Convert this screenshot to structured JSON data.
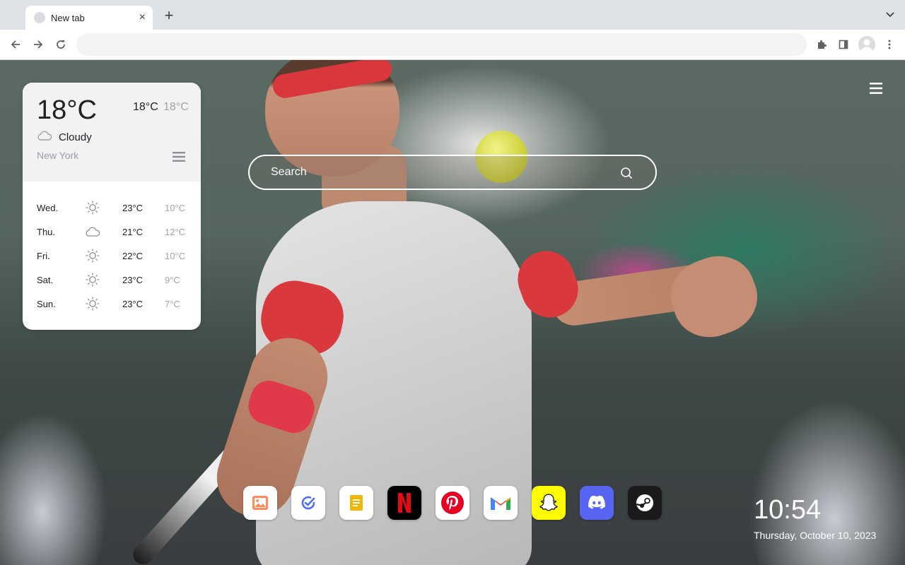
{
  "browser": {
    "tab": {
      "title": "New tab",
      "close": "×"
    },
    "new_tab": "+",
    "address": ""
  },
  "weather": {
    "current_temp": "18°C",
    "high": "18°C",
    "low": "18°C",
    "condition": "Cloudy",
    "city": "New York",
    "forecast": [
      {
        "day": "Wed.",
        "icon": "sun-icon",
        "high": "23°C",
        "low": "10°C"
      },
      {
        "day": "Thu.",
        "icon": "cloud-icon",
        "high": "21°C",
        "low": "12°C"
      },
      {
        "day": "Fri.",
        "icon": "sun-icon",
        "high": "22°C",
        "low": "10°C"
      },
      {
        "day": "Sat.",
        "icon": "sun-icon",
        "high": "23°C",
        "low": "9°C"
      },
      {
        "day": "Sun.",
        "icon": "sun-icon",
        "high": "23°C",
        "low": "7°C"
      }
    ]
  },
  "search": {
    "placeholder": "Search"
  },
  "dock": [
    {
      "name": "photos-app",
      "icon": "image-icon",
      "color": "#ffffff"
    },
    {
      "name": "tasks-app",
      "icon": "check-circle-icon",
      "color": "#ffffff"
    },
    {
      "name": "notes-app",
      "icon": "note-icon",
      "color": "#ffffff"
    },
    {
      "name": "netflix-app",
      "icon": "netflix-icon",
      "color": "#000000"
    },
    {
      "name": "pinterest-app",
      "icon": "pinterest-icon",
      "color": "#ffffff"
    },
    {
      "name": "gmail-app",
      "icon": "gmail-icon",
      "color": "#ffffff"
    },
    {
      "name": "snapchat-app",
      "icon": "snapchat-icon",
      "color": "#fffc00"
    },
    {
      "name": "discord-app",
      "icon": "discord-icon",
      "color": "#5865f2"
    },
    {
      "name": "steam-app",
      "icon": "steam-icon",
      "color": "#1b1b1d"
    }
  ],
  "clock": {
    "time": "10:54",
    "date": "Thursday, October 10, 2023"
  }
}
